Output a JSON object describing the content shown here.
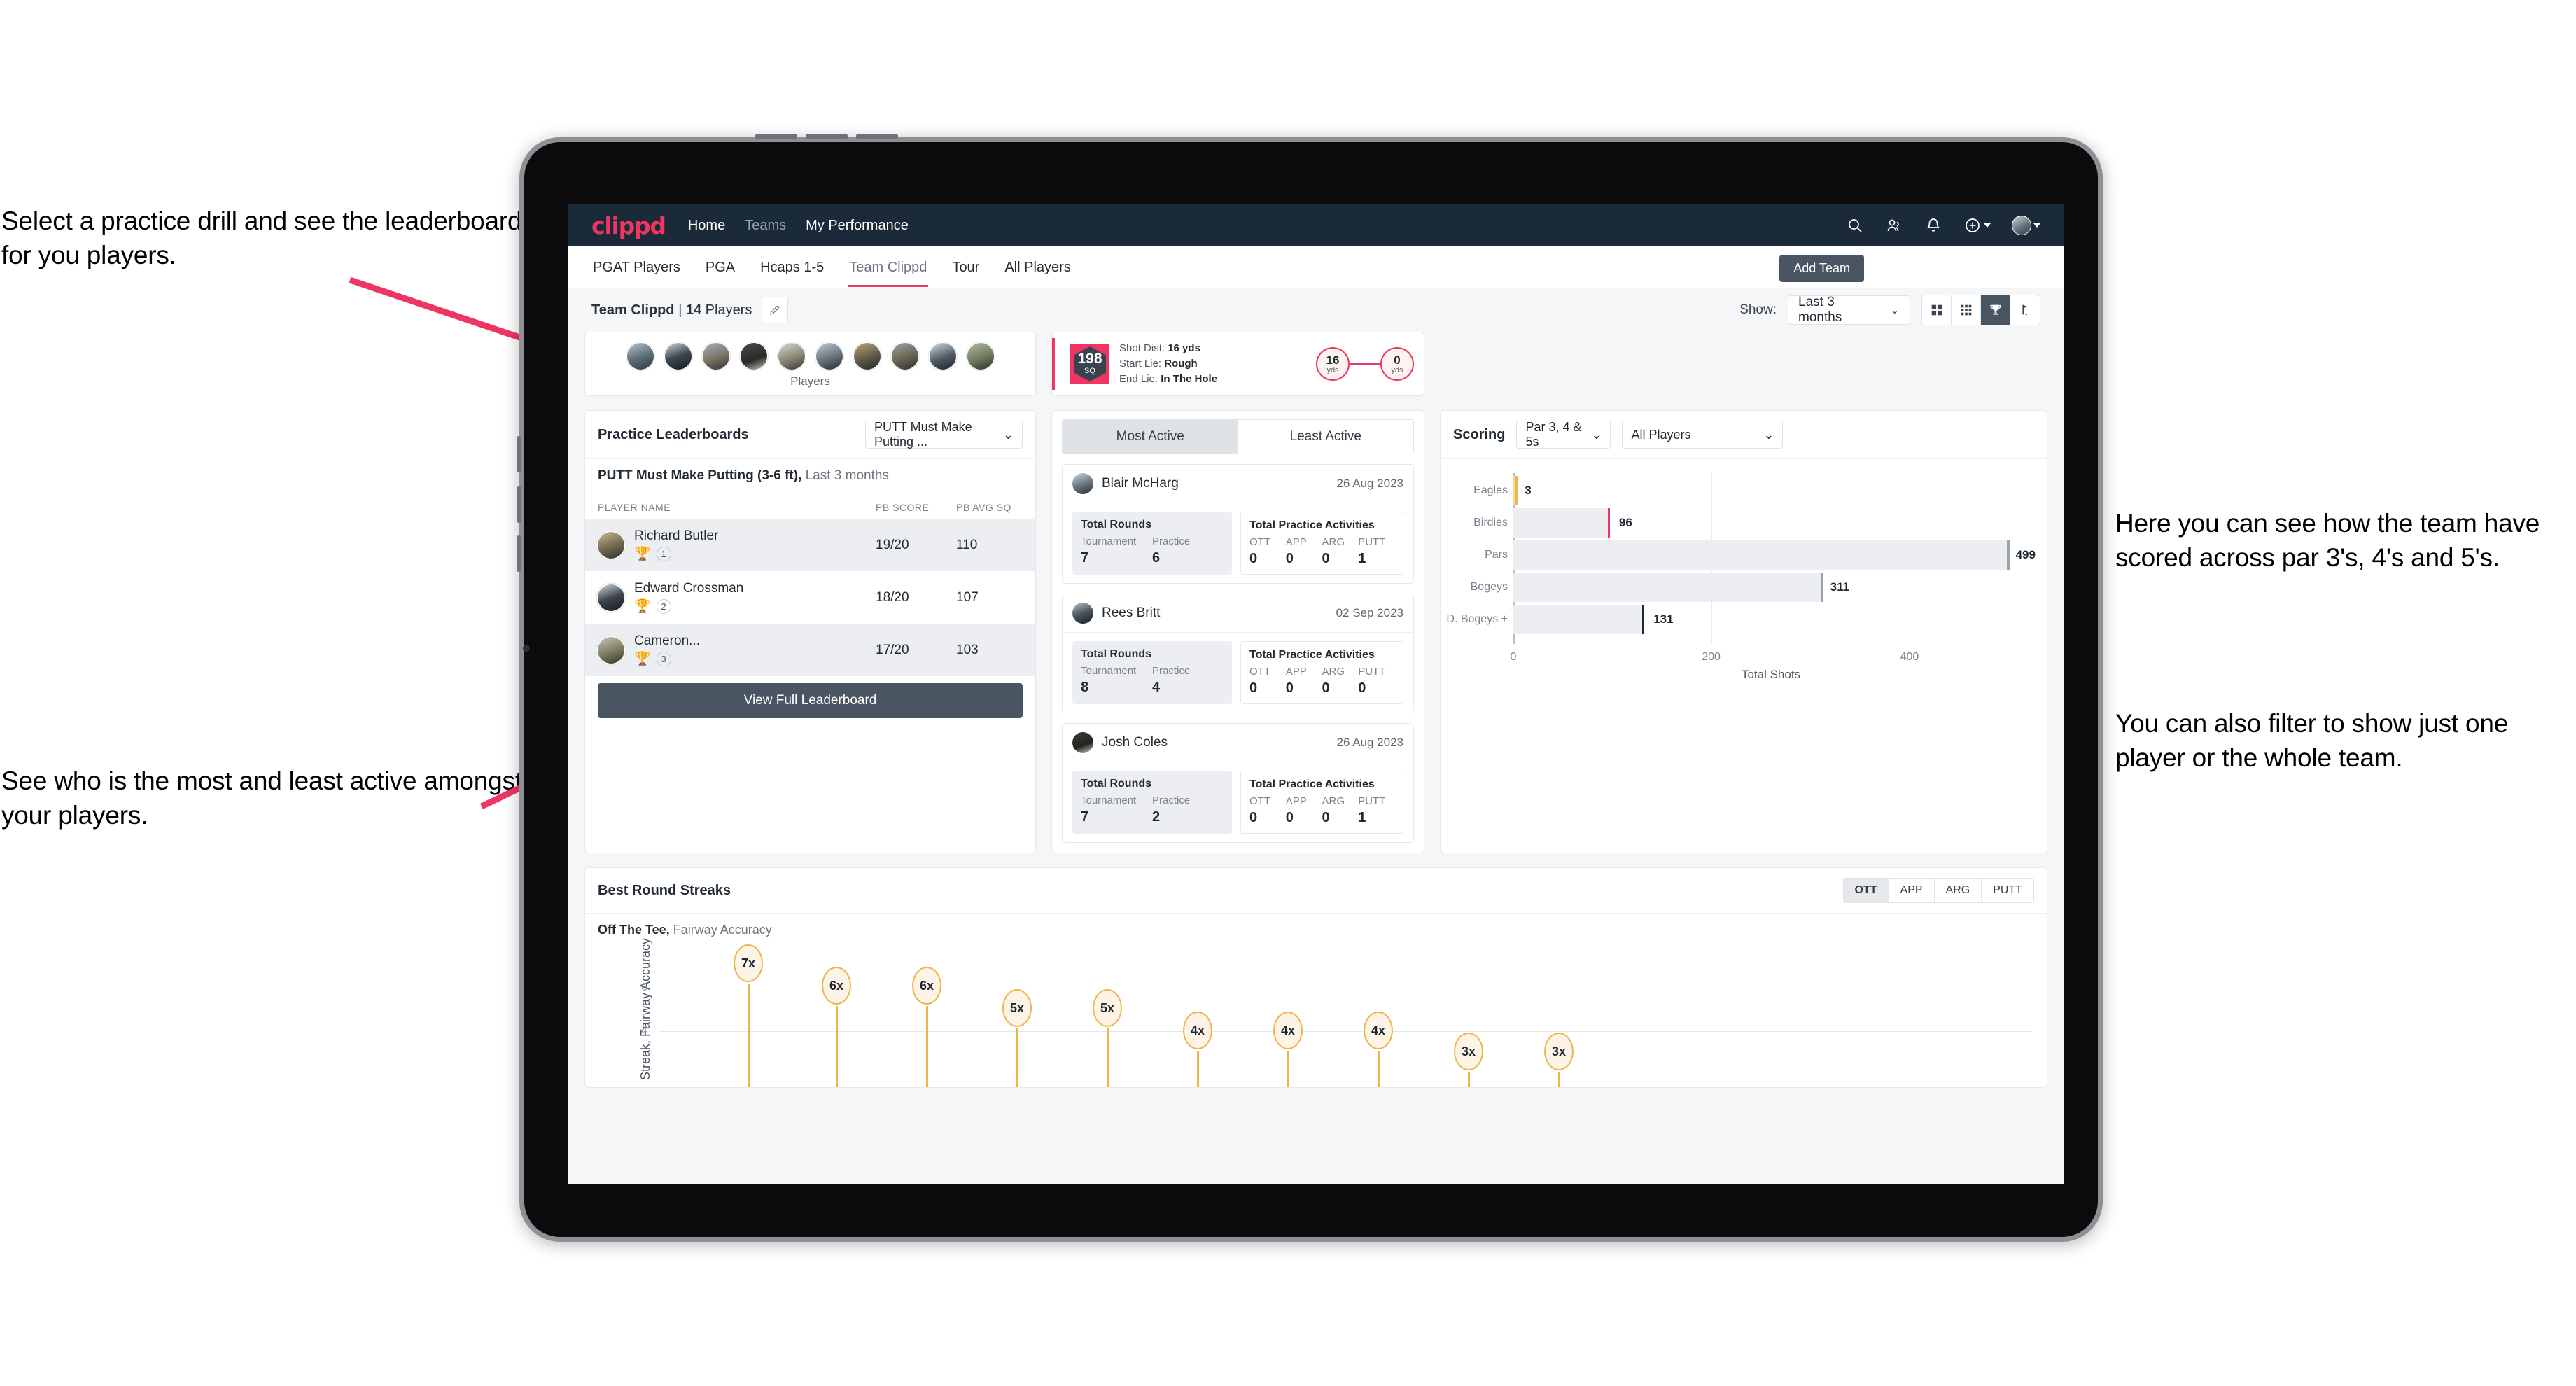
{
  "annotations": {
    "a": "Select a practice drill and see the leaderboard for you players.",
    "b": "See who is the most and least active amongst your players.",
    "c": "Here you can see how the team have scored across par 3's, 4's and 5's.",
    "d": "You can also filter to show just one player or the whole team."
  },
  "topnav": {
    "logo": "clippd",
    "links": [
      {
        "label": "Home",
        "dim": false
      },
      {
        "label": "Teams",
        "dim": true
      },
      {
        "label": "My Performance",
        "dim": false
      }
    ],
    "icons": [
      "search-icon",
      "people-icon",
      "bell-icon",
      "plus-circle-icon",
      "avatar"
    ]
  },
  "tabs": [
    {
      "label": "PGAT Players",
      "active": false
    },
    {
      "label": "PGA",
      "active": false
    },
    {
      "label": "Hcaps 1-5",
      "active": false
    },
    {
      "label": "Team Clippd",
      "active": true
    },
    {
      "label": "Tour",
      "active": false
    },
    {
      "label": "All Players",
      "active": false
    }
  ],
  "add_team_label": "Add Team",
  "subheader": {
    "team_name": "Team Clippd",
    "player_count": "14",
    "players_word": "Players",
    "show_label": "Show:",
    "period": "Last 3 months",
    "view_buttons": [
      "grid-large-icon",
      "grid-small-icon",
      "trophy-icon",
      "flag-icon"
    ],
    "active_view": 2
  },
  "players_card": {
    "label": "Players",
    "count": 10
  },
  "shot_card": {
    "sq_value": "198",
    "sq_unit": "SQ",
    "lines": [
      {
        "k": "Shot Dist:",
        "v": "16 yds"
      },
      {
        "k": "Start Lie:",
        "v": "Rough"
      },
      {
        "k": "End Lie:",
        "v": "In The Hole"
      }
    ],
    "start_dist": "16",
    "start_unit": "yds",
    "end_dist": "0",
    "end_unit": "yds"
  },
  "leaderboard": {
    "title": "Practice Leaderboards",
    "drill_select": "PUTT Must Make Putting ...",
    "subtitle_bold": "PUTT Must Make Putting (3-6 ft),",
    "subtitle_rest": " Last 3 months",
    "columns": [
      "PLAYER NAME",
      "PB SCORE",
      "PB AVG SQ"
    ],
    "rows": [
      {
        "name": "Richard Butler",
        "trophy": "gold",
        "rank": "1",
        "score": "19/20",
        "avg": "110"
      },
      {
        "name": "Edward Crossman",
        "trophy": "silver",
        "rank": "2",
        "score": "18/20",
        "avg": "107"
      },
      {
        "name": "Cameron...",
        "trophy": "bronze",
        "rank": "3",
        "score": "17/20",
        "avg": "103"
      }
    ],
    "view_full_label": "View Full Leaderboard"
  },
  "activity": {
    "tabs": [
      {
        "label": "Most Active",
        "active": true
      },
      {
        "label": "Least Active",
        "active": false
      }
    ],
    "rounds_title": "Total Rounds",
    "practice_title": "Total Practice Activities",
    "rounds_keys": [
      "Tournament",
      "Practice"
    ],
    "practice_keys": [
      "OTT",
      "APP",
      "ARG",
      "PUTT"
    ],
    "cards": [
      {
        "name": "Blair McHarg",
        "date": "26 Aug 2023",
        "tournament": "7",
        "practice": "6",
        "ott": "0",
        "app": "0",
        "arg": "0",
        "putt": "1"
      },
      {
        "name": "Rees Britt",
        "date": "02 Sep 2023",
        "tournament": "8",
        "practice": "4",
        "ott": "0",
        "app": "0",
        "arg": "0",
        "putt": "0"
      },
      {
        "name": "Josh Coles",
        "date": "26 Aug 2023",
        "tournament": "7",
        "practice": "2",
        "ott": "0",
        "app": "0",
        "arg": "0",
        "putt": "1"
      }
    ]
  },
  "scoring": {
    "title": "Scoring",
    "par_select": "Par 3, 4 & 5s",
    "players_select": "All Players"
  },
  "streaks": {
    "title": "Best Round Streaks",
    "segments": [
      {
        "label": "OTT",
        "active": true
      },
      {
        "label": "APP",
        "active": false
      },
      {
        "label": "ARG",
        "active": false
      },
      {
        "label": "PUTT",
        "active": false
      }
    ],
    "sub_bold": "Off The Tee,",
    "sub_rest": " Fairway Accuracy"
  },
  "chart_data": [
    {
      "type": "bar",
      "orientation": "horizontal",
      "title": "Scoring",
      "categories": [
        "Eagles",
        "Birdies",
        "Pars",
        "Bogeys",
        "D. Bogeys +"
      ],
      "values": [
        3,
        96,
        499,
        311,
        131
      ],
      "cap_colors": [
        "#edb64d",
        "#ef3562",
        "#9aa2aa",
        "#9aa2aa",
        "#1f2730"
      ],
      "xlabel": "Total Shots",
      "ylabel": "",
      "xlim": [
        0,
        520
      ],
      "xticks": [
        0,
        200,
        400
      ],
      "grid": true,
      "legend": "none"
    },
    {
      "type": "bar",
      "orientation": "vertical",
      "title": "Best Round Streaks",
      "subtitle": "Off The Tee, Fairway Accuracy",
      "categories": [
        "1",
        "2",
        "3",
        "4",
        "5",
        "6",
        "7",
        "8",
        "9",
        "10"
      ],
      "values": [
        7,
        6,
        6,
        5,
        5,
        4,
        4,
        4,
        3,
        3
      ],
      "point_labels": [
        "7x",
        "6x",
        "6x",
        "5x",
        "5x",
        "4x",
        "4x",
        "4x",
        "3x",
        "3x"
      ],
      "ylabel": "Streak, Fairway Accuracy",
      "xlabel": "",
      "ylim": [
        0,
        8
      ],
      "yticks": [
        4,
        6
      ],
      "grid": true,
      "legend": "none"
    }
  ]
}
